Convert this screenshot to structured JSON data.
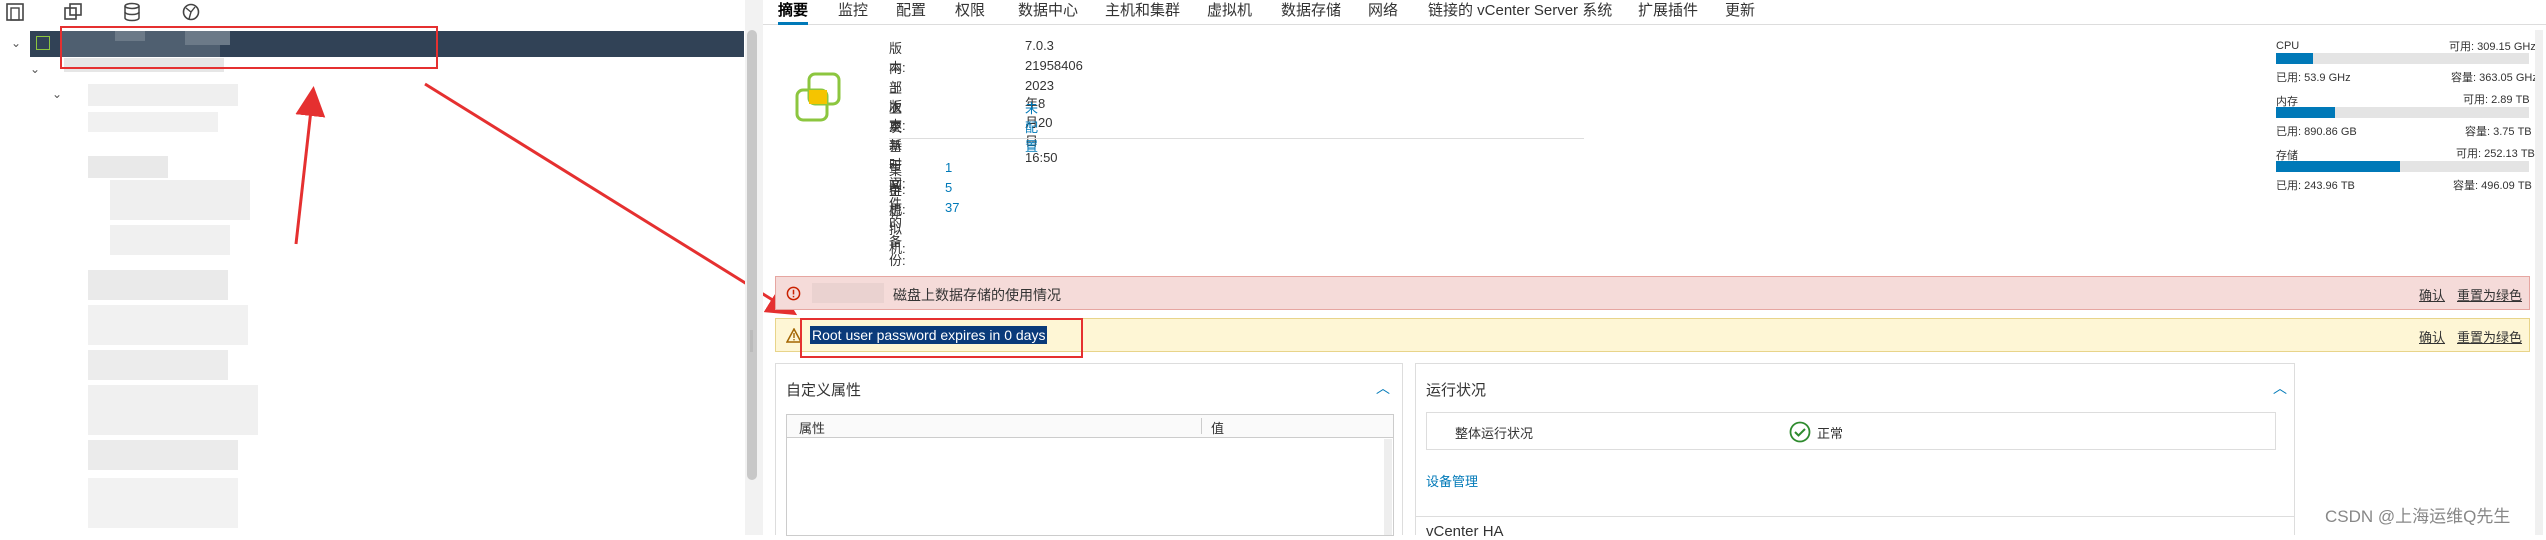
{
  "tabs": [
    "摘要",
    "监控",
    "配置",
    "权限",
    "数据中心",
    "主机和集群",
    "虚拟机",
    "数据存储",
    "网络",
    "链接的 vCenter Server 系统",
    "扩展插件",
    "更新"
  ],
  "summary": {
    "rows": [
      {
        "k": "版本:",
        "v": "7.0.3"
      },
      {
        "k": "内部版本:",
        "v": "21958406"
      },
      {
        "k": "上次更新时间:",
        "v": "2023年8月20日 16:50"
      },
      {
        "k": "上次基于文件的备份:",
        "v": "未配置",
        "link": true
      }
    ],
    "counts": [
      {
        "k": "集群:",
        "v": "1"
      },
      {
        "k": "主机:",
        "v": "5"
      },
      {
        "k": "虚拟机:",
        "v": "37"
      }
    ]
  },
  "resources": {
    "cpu": {
      "label": "CPU",
      "free": "可用: 309.15 GHz",
      "used": "已用: 53.9 GHz",
      "cap": "容量: 363.05 GHz",
      "fraction": 0.148
    },
    "mem": {
      "label": "内存",
      "free": "可用: 2.89 TB",
      "used": "已用: 890.86 GB",
      "cap": "容量: 3.75 TB",
      "fraction": 0.232
    },
    "sto": {
      "label": "存储",
      "free": "可用: 252.13 TB",
      "used": "已用: 243.96 TB",
      "cap": "容量: 496.09 TB",
      "fraction": 0.492
    }
  },
  "alerts": {
    "disk": {
      "text": "磁盘上数据存储的使用情况",
      "ack": "确认",
      "reset": "重置为绿色"
    },
    "password": {
      "text": "Root user password expires in 0 days",
      "ack": "确认",
      "reset": "重置为绿色"
    }
  },
  "custom_attrs": {
    "title": "自定义属性",
    "col1": "属性",
    "col2": "值"
  },
  "health": {
    "title": "运行状况",
    "row_label": "整体运行状况",
    "row_value": "正常",
    "link": "设备管理"
  },
  "vcha": {
    "title": "vCenter HA"
  },
  "watermark": "CSDN @上海运维Q先生",
  "colors": {
    "accent": "#0079b8",
    "error_bg": "#f5dbd9",
    "warn_bg": "#fef6d5",
    "annotation": "#e53030"
  }
}
